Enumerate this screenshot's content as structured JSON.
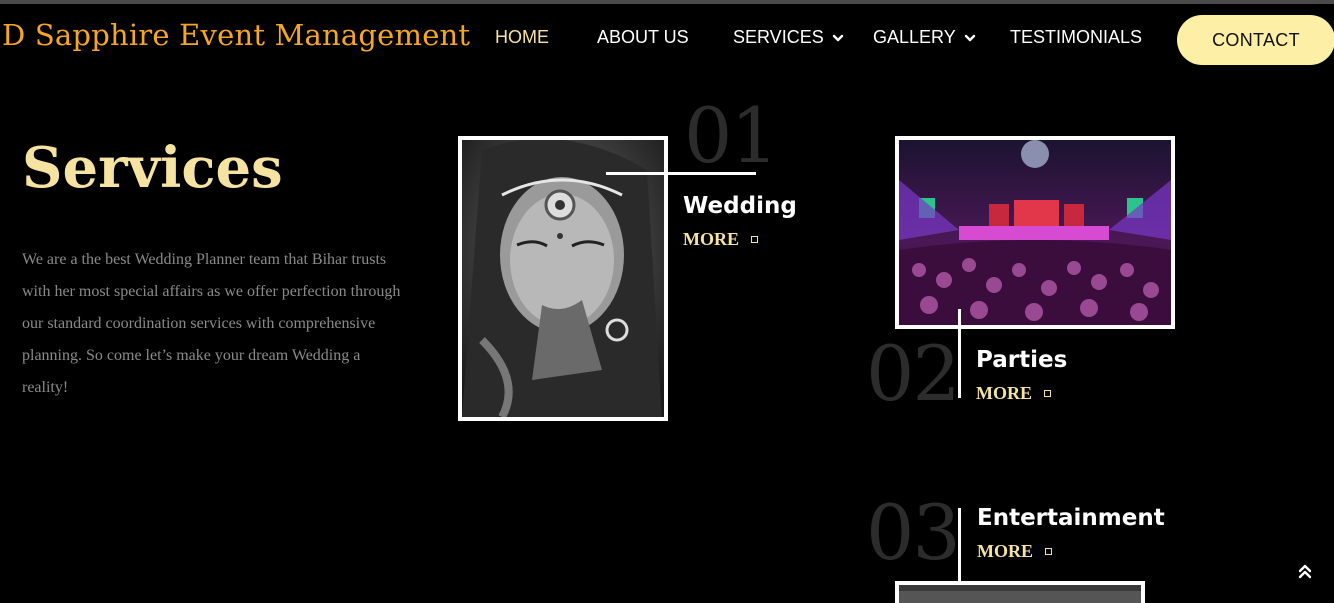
{
  "header": {
    "brand": "D Sapphire Event Management",
    "nav": [
      {
        "label": "HOME",
        "active": true
      },
      {
        "label": "ABOUT US"
      },
      {
        "label": "SERVICES"
      },
      {
        "label": "GALLERY"
      },
      {
        "label": "TESTIMONIALS"
      }
    ],
    "contact_label": "CONTACT"
  },
  "intro": {
    "title": "Services",
    "description": "We are a the best Wedding Planner team that Bihar trusts with her most special affairs as we offer perfection through our standard coordination services with comprehensive planning. So come let’s make your dream Wedding a reality!"
  },
  "cards": [
    {
      "number": "01",
      "title": "Wedding",
      "more": "MORE"
    },
    {
      "number": "02",
      "title": "Parties",
      "more": "MORE"
    },
    {
      "number": "03",
      "title": "Entertainment",
      "more": "MORE"
    }
  ],
  "colors": {
    "brand": "#f5a623",
    "accent": "#f7e3a1",
    "contact_bg": "#fdf0a6",
    "background": "#000000"
  },
  "icons": {
    "nav_dropdown": "chevron-down-icon",
    "scroll_top": "double-chevron-up-icon"
  }
}
